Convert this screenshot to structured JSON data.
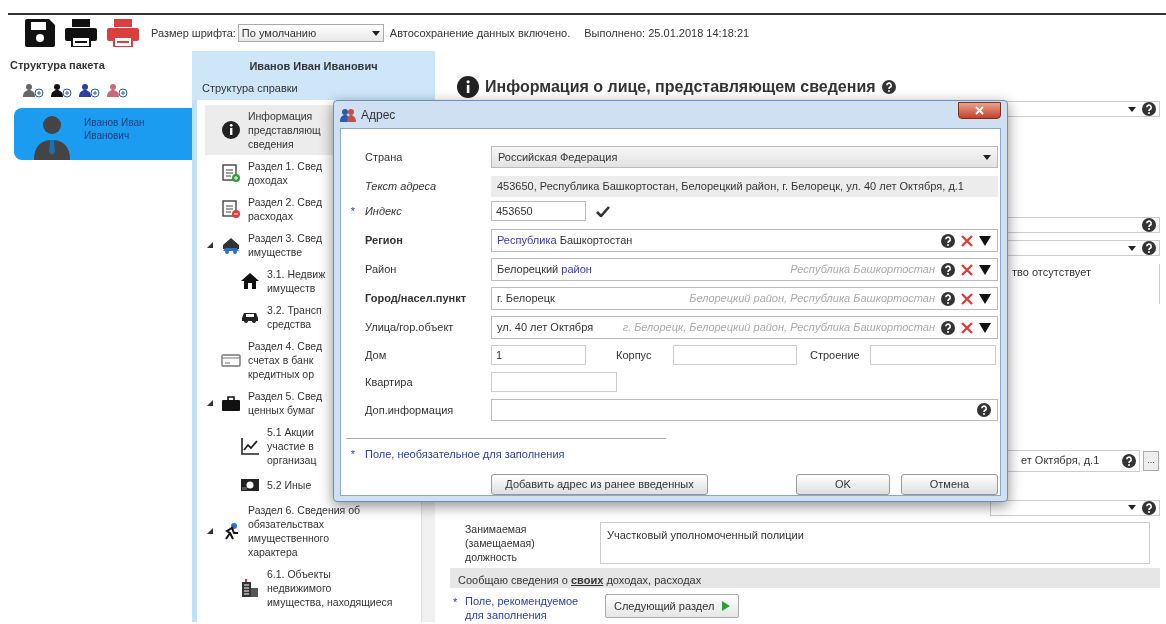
{
  "toolbar": {
    "font_size_label": "Размер шрифта:",
    "font_size_value": "По умолчанию",
    "autosave": "Автосохранение данных включено.",
    "completed": "Выполнено: 25.01.2018 14:18:21"
  },
  "package": {
    "title": "Структура пакета",
    "items": [
      {
        "name": "Иванов Иван\nИванович",
        "selected": true
      }
    ]
  },
  "certificate": {
    "person": "Иванов Иван Иванович",
    "subtitle": "Структура справки",
    "tree": [
      {
        "kind": "info",
        "label": "Информация\nпредставляющ\nсведения",
        "selected": true
      },
      {
        "kind": "income",
        "label": "Раздел 1. Свед\nдоходах",
        "selected": false
      },
      {
        "kind": "expense",
        "label": "Раздел 2. Свед\nрасходах",
        "selected": false
      },
      {
        "kind": "property",
        "label": "Раздел 3. Свед\nимуществе",
        "selected": false,
        "expanded": true,
        "children": [
          {
            "kind": "house",
            "label": "3.1. Недвиж\nимуществ",
            "selected": false
          },
          {
            "kind": "car",
            "label": "3.2. Трансп\nсредства",
            "selected": false
          }
        ]
      },
      {
        "kind": "card",
        "label": "Раздел 4. Свед\nсчетах в банк\nкредитных ор",
        "selected": false
      },
      {
        "kind": "briefcase",
        "label": "Раздел 5. Свед\nценных бумаг",
        "selected": false,
        "expanded": true,
        "children": [
          {
            "kind": "chart",
            "label": "5.1 Акции\nучастие в\nорганизац",
            "selected": false
          },
          {
            "kind": "money",
            "label": "5.2 Иные",
            "selected": false
          }
        ]
      },
      {
        "kind": "obligations",
        "label": "Раздел 6. Сведения об\nобязательствах\nимущественного\nхарактера",
        "selected": false,
        "expanded": true,
        "children": [
          {
            "kind": "building",
            "label": "6.1. Объекты\nнедвижимого\nимущества, находящиеся",
            "selected": false
          }
        ]
      }
    ]
  },
  "main": {
    "heading": "Информация о лице, представляющем сведения",
    "rows": [
      {
        "kind": "select"
      },
      {
        "kind": "field"
      },
      {
        "kind": "select"
      },
      {
        "kind": "note",
        "text": "тво отсутствует"
      },
      {
        "kind": "address",
        "value": "ет Октября, д.1",
        "button": "..."
      },
      {
        "kind": "select"
      },
      {
        "kind": "textarea",
        "label": "Занимаемая\n(замещаемая)\nдолжность",
        "value": "Участковый уполномоченный полиции"
      },
      {
        "kind": "bar",
        "text": "Сообщаю сведения о **своих** доходах, расходах"
      }
    ],
    "footer": {
      "mark": "*",
      "note": "Поле, рекомендуемое\nдля заполнения",
      "next_button": "Следующий раздел"
    }
  },
  "dialog": {
    "title": "Адрес",
    "rows": [
      {
        "kind": "select",
        "label": "Страна",
        "required": false,
        "optional": false,
        "computed": false,
        "value": "Российская Федерация"
      },
      {
        "kind": "readonly",
        "label": "Текст адреса",
        "required": false,
        "optional": false,
        "computed": true,
        "value": "453650, Республика Башкортостан, Белорецкий район, г. Белорецк, ул. 40 лет Октября, д.1"
      },
      {
        "kind": "index",
        "label": "Индекс",
        "required": false,
        "optional": true,
        "computed": false,
        "mark": "*",
        "value": "453650",
        "valid": true
      },
      {
        "kind": "lookup",
        "label": "Регион",
        "required": true,
        "optional": false,
        "computed": false,
        "parts": [
          {
            "text": "Республика",
            "kind": "type"
          },
          {
            "text": "Башкортостан",
            "kind": "name"
          }
        ]
      },
      {
        "kind": "lookup",
        "label": "Район",
        "required": false,
        "optional": false,
        "computed": false,
        "parts": [
          {
            "text": "Белорецкий",
            "kind": "name"
          },
          {
            "text": "район",
            "kind": "type"
          }
        ],
        "hint": "Республика Башкортостан"
      },
      {
        "kind": "lookup",
        "label": "Город/насел.пункт",
        "required": true,
        "optional": false,
        "computed": false,
        "parts": [
          {
            "text": "г. Белорецк",
            "kind": "name"
          }
        ],
        "hint": "Белорецкий район, Республика Башкортостан"
      },
      {
        "kind": "lookup",
        "label": "Улица/гор.объект",
        "required": false,
        "optional": false,
        "computed": false,
        "parts": [
          {
            "text": "ул. 40 лет Октября",
            "kind": "name"
          }
        ],
        "hint": "г. Белорецк, Белорецкий район, Республика Башкортостан"
      },
      {
        "kind": "house",
        "label": "Дом",
        "value": "1",
        "fields": [
          {
            "label": "Корпус"
          },
          {
            "label": "Строение"
          }
        ]
      },
      {
        "kind": "short",
        "label": "Квартира"
      },
      {
        "kind": "wide",
        "label": "Доп.информация"
      }
    ],
    "footnote": {
      "mark": "*",
      "text": "Поле, необязательное для заполнения"
    },
    "buttons": [
      {
        "kind": "add",
        "label": "Добавить адрес из ранее введенных"
      },
      {
        "kind": "ok",
        "label": "OK"
      },
      {
        "kind": "cancel",
        "label": "Отмена"
      }
    ]
  }
}
